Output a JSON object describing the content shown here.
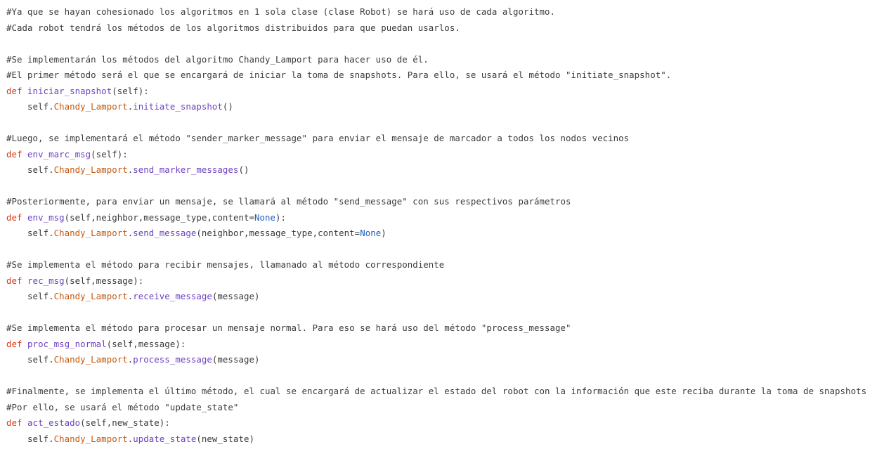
{
  "colors": {
    "background": "#ffffff",
    "comment": "#3b3b3b",
    "keyword": "#d63a1a",
    "function": "#6f42c1",
    "attribute": "#c55a11",
    "constant": "#1f5fbf",
    "text": "#3a3a3a"
  },
  "lines": [
    [
      {
        "t": "c",
        "s": "#Ya que se hayan cohesionado los algoritmos en 1 sola clase (clase Robot) se hará uso de cada algoritmo."
      }
    ],
    [
      {
        "t": "c",
        "s": "#Cada robot tendrá los métodos de los algoritmos distribuidos para que puedan usarlos."
      }
    ],
    [],
    [
      {
        "t": "c",
        "s": "#Se implementarán los métodos del algoritmo Chandy_Lamport para hacer uso de él."
      }
    ],
    [
      {
        "t": "c",
        "s": "#El primer método será el que se encargará de iniciar la toma de snapshots. Para ello, se usará el método \"initiate_snapshot\"."
      }
    ],
    [
      {
        "t": "kw",
        "s": "def"
      },
      {
        "t": "tx",
        "s": " "
      },
      {
        "t": "fn",
        "s": "iniciar_snapshot"
      },
      {
        "t": "tx",
        "s": "(self):"
      }
    ],
    [
      {
        "t": "tx",
        "s": "    self."
      },
      {
        "t": "at",
        "s": "Chandy_Lamport"
      },
      {
        "t": "tx",
        "s": "."
      },
      {
        "t": "fn",
        "s": "initiate_snapshot"
      },
      {
        "t": "tx",
        "s": "()"
      }
    ],
    [],
    [
      {
        "t": "c",
        "s": "#Luego, se implementará el método \"sender_marker_message\" para enviar el mensaje de marcador a todos los nodos vecinos"
      }
    ],
    [
      {
        "t": "kw",
        "s": "def"
      },
      {
        "t": "tx",
        "s": " "
      },
      {
        "t": "fn",
        "s": "env_marc_msg"
      },
      {
        "t": "tx",
        "s": "(self):"
      }
    ],
    [
      {
        "t": "tx",
        "s": "    self."
      },
      {
        "t": "at",
        "s": "Chandy_Lamport"
      },
      {
        "t": "tx",
        "s": "."
      },
      {
        "t": "fn",
        "s": "send_marker_messages"
      },
      {
        "t": "tx",
        "s": "()"
      }
    ],
    [],
    [
      {
        "t": "c",
        "s": "#Posteriormente, para enviar un mensaje, se llamará al método \"send_message\" con sus respectivos parámetros"
      }
    ],
    [
      {
        "t": "kw",
        "s": "def"
      },
      {
        "t": "tx",
        "s": " "
      },
      {
        "t": "fn",
        "s": "env_msg"
      },
      {
        "t": "tx",
        "s": "(self,neighbor,message_type,content="
      },
      {
        "t": "cn",
        "s": "None"
      },
      {
        "t": "tx",
        "s": "):"
      }
    ],
    [
      {
        "t": "tx",
        "s": "    self."
      },
      {
        "t": "at",
        "s": "Chandy_Lamport"
      },
      {
        "t": "tx",
        "s": "."
      },
      {
        "t": "fn",
        "s": "send_message"
      },
      {
        "t": "tx",
        "s": "(neighbor,message_type,content="
      },
      {
        "t": "cn",
        "s": "None"
      },
      {
        "t": "tx",
        "s": ")"
      }
    ],
    [],
    [
      {
        "t": "c",
        "s": "#Se implementa el método para recibir mensajes, llamanado al método correspondiente"
      }
    ],
    [
      {
        "t": "kw",
        "s": "def"
      },
      {
        "t": "tx",
        "s": " "
      },
      {
        "t": "fn",
        "s": "rec_msg"
      },
      {
        "t": "tx",
        "s": "(self,message):"
      }
    ],
    [
      {
        "t": "tx",
        "s": "    self."
      },
      {
        "t": "at",
        "s": "Chandy_Lamport"
      },
      {
        "t": "tx",
        "s": "."
      },
      {
        "t": "fn",
        "s": "receive_message"
      },
      {
        "t": "tx",
        "s": "(message)"
      }
    ],
    [],
    [
      {
        "t": "c",
        "s": "#Se implementa el método para procesar un mensaje normal. Para eso se hará uso del método \"process_message\""
      }
    ],
    [
      {
        "t": "kw",
        "s": "def"
      },
      {
        "t": "tx",
        "s": " "
      },
      {
        "t": "fn",
        "s": "proc_msg_normal"
      },
      {
        "t": "tx",
        "s": "(self,message):"
      }
    ],
    [
      {
        "t": "tx",
        "s": "    self."
      },
      {
        "t": "at",
        "s": "Chandy_Lamport"
      },
      {
        "t": "tx",
        "s": "."
      },
      {
        "t": "fn",
        "s": "process_message"
      },
      {
        "t": "tx",
        "s": "(message)"
      }
    ],
    [],
    [
      {
        "t": "c",
        "s": "#Finalmente, se implementa el último método, el cual se encargará de actualizar el estado del robot con la información que este reciba durante la toma de snapshots"
      }
    ],
    [
      {
        "t": "c",
        "s": "#Por ello, se usará el método \"update_state\""
      }
    ],
    [
      {
        "t": "kw",
        "s": "def"
      },
      {
        "t": "tx",
        "s": " "
      },
      {
        "t": "fn",
        "s": "act_estado"
      },
      {
        "t": "tx",
        "s": "(self,new_state):"
      }
    ],
    [
      {
        "t": "tx",
        "s": "    self."
      },
      {
        "t": "at",
        "s": "Chandy_Lamport"
      },
      {
        "t": "tx",
        "s": "."
      },
      {
        "t": "fn",
        "s": "update_state"
      },
      {
        "t": "tx",
        "s": "(new_state)"
      }
    ]
  ]
}
